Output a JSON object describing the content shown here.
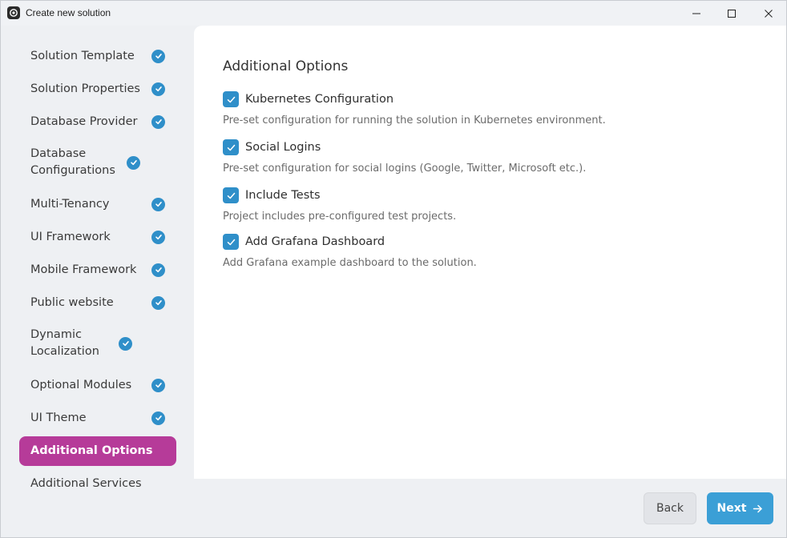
{
  "window": {
    "title": "Create new solution"
  },
  "sidebar": {
    "items": [
      {
        "label": "Solution Template",
        "done": true
      },
      {
        "label": "Solution Properties",
        "done": true
      },
      {
        "label": "Database Provider",
        "done": true
      },
      {
        "label": "Database Configurations",
        "done": true
      },
      {
        "label": "Multi-Tenancy",
        "done": true
      },
      {
        "label": "UI Framework",
        "done": true
      },
      {
        "label": "Mobile Framework",
        "done": true
      },
      {
        "label": "Public website",
        "done": true
      },
      {
        "label": "Dynamic Localization",
        "done": true
      },
      {
        "label": "Optional Modules",
        "done": true
      },
      {
        "label": "UI Theme",
        "done": true
      },
      {
        "label": "Additional Options",
        "active": true
      },
      {
        "label": "Additional Services"
      }
    ]
  },
  "main": {
    "title": "Additional Options",
    "options": [
      {
        "label": "Kubernetes Configuration",
        "checked": true,
        "description": "Pre-set configuration for running the solution in Kubernetes environment."
      },
      {
        "label": "Social Logins",
        "checked": true,
        "description": "Pre-set configuration for social logins (Google, Twitter, Microsoft etc.)."
      },
      {
        "label": "Include Tests",
        "checked": true,
        "description": "Project includes pre-configured test projects."
      },
      {
        "label": "Add Grafana Dashboard",
        "checked": true,
        "description": "Add Grafana example dashboard to the solution."
      }
    ]
  },
  "footer": {
    "back_label": "Back",
    "next_label": "Next"
  },
  "colors": {
    "accent": "#2f8fc9",
    "active_step": "#b63b99",
    "next_button": "#3b9fd6"
  },
  "icons": {
    "app": "abp-logo-icon",
    "check": "check-icon",
    "next": "arrow-right-icon"
  }
}
